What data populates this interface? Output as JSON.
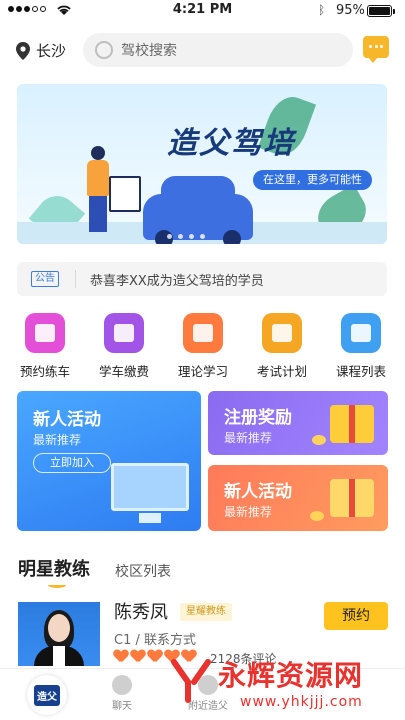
{
  "status_bar": {
    "time": "4:21 PM",
    "battery": "95%"
  },
  "header": {
    "city": "长沙",
    "search_placeholder": "驾校搜索"
  },
  "banner": {
    "title": "造父驾培",
    "subtitle": "在这里，更多可能性"
  },
  "notice": {
    "tag": "公告",
    "text": "恭喜李XX成为造父驾培的学员"
  },
  "entries": [
    {
      "label": "预约练车",
      "color": "#e34fd6",
      "icon": "car-icon"
    },
    {
      "label": "学车缴费",
      "color": "#a254e6",
      "icon": "wallet-icon"
    },
    {
      "label": "理论学习",
      "color": "#ff7a3c",
      "icon": "book-icon"
    },
    {
      "label": "考试计划",
      "color": "#f5a623",
      "icon": "calendar-icon"
    },
    {
      "label": "课程列表",
      "color": "#3fa0f2",
      "icon": "grid-icon"
    }
  ],
  "activities": {
    "big": {
      "title": "新人活动",
      "subtitle": "最新推荐",
      "button": "立即加入"
    },
    "right_top": {
      "title": "注册奖励",
      "subtitle": "最新推荐"
    },
    "right_bottom": {
      "title": "新人活动",
      "subtitle": "最新推荐"
    }
  },
  "section_tabs": {
    "active": "明星教练",
    "other": "校区列表"
  },
  "coach": {
    "name": "陈秀凤",
    "badge": "星耀教练",
    "info": "C1 / 联系方式",
    "rating": 5,
    "reviews": "2128条评论",
    "book_label": "预约"
  },
  "bottom_nav": {
    "logo_text": "造父",
    "items": [
      {
        "label": "聊天"
      },
      {
        "label": "附近造父"
      }
    ]
  },
  "watermark": {
    "text": "永辉资源网",
    "url": "www.yhkjjj.com"
  },
  "colors": {
    "accent": "#f7b72b",
    "primary_blue": "#2e7cf2"
  }
}
